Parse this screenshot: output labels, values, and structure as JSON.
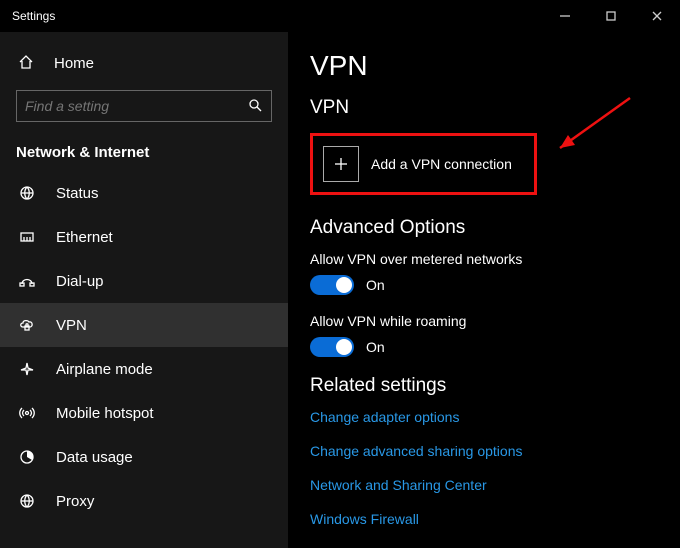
{
  "window": {
    "title": "Settings"
  },
  "sidebar": {
    "home": "Home",
    "search_placeholder": "Find a setting",
    "category": "Network & Internet",
    "items": [
      {
        "label": "Status"
      },
      {
        "label": "Ethernet"
      },
      {
        "label": "Dial-up"
      },
      {
        "label": "VPN"
      },
      {
        "label": "Airplane mode"
      },
      {
        "label": "Mobile hotspot"
      },
      {
        "label": "Data usage"
      },
      {
        "label": "Proxy"
      }
    ]
  },
  "page": {
    "title": "VPN",
    "section_title": "VPN",
    "add_button": "Add a VPN connection",
    "advanced_title": "Advanced Options",
    "opt_metered": {
      "label": "Allow VPN over metered networks",
      "state": "On"
    },
    "opt_roaming": {
      "label": "Allow VPN while roaming",
      "state": "On"
    },
    "related_title": "Related settings",
    "links": [
      "Change adapter options",
      "Change advanced sharing options",
      "Network and Sharing Center",
      "Windows Firewall"
    ]
  },
  "colors": {
    "callout": "#e11",
    "accent": "#0a6cd6",
    "link": "#2998e6"
  }
}
